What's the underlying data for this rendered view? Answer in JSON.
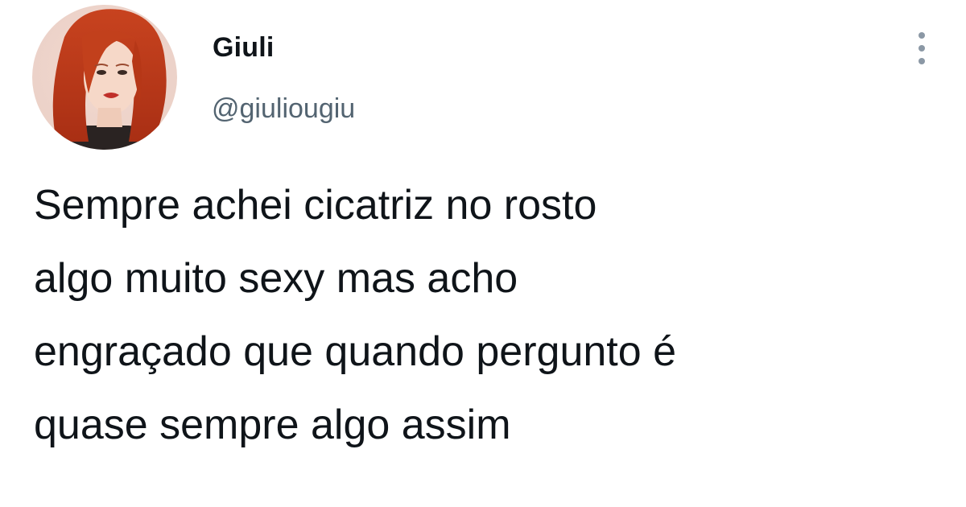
{
  "tweet": {
    "author": {
      "display_name": "Giuli",
      "handle": "@giuliougiu",
      "avatar_icon": "profile-photo"
    },
    "more_icon": "vertical-dots-icon",
    "text_lines": [
      "Sempre achei cicatriz no rosto",
      "algo muito sexy mas acho",
      "engraçado que quando pergunto é",
      "quase sempre algo assim"
    ]
  },
  "colors": {
    "text_primary": "#0f1419",
    "text_secondary": "#536471",
    "icon_more": "#8b98a5",
    "background": "#ffffff"
  }
}
